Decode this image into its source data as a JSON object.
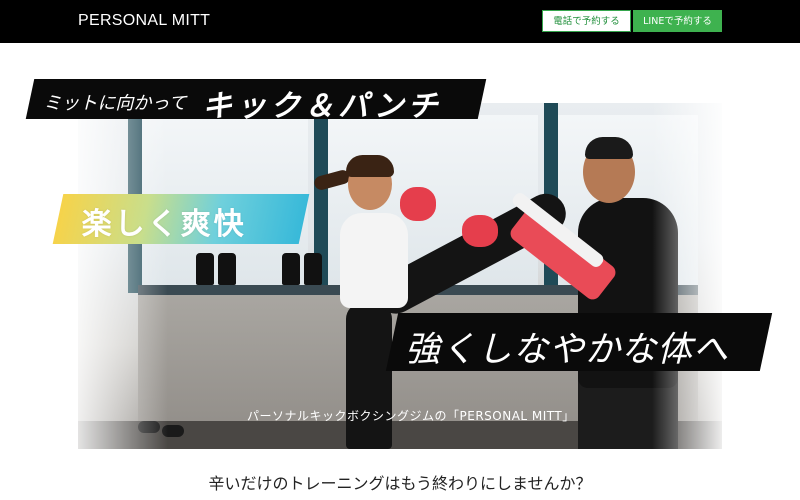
{
  "header": {
    "brand": "PERSONAL MITT",
    "tel_button": "電話で予約する",
    "line_button": "LINEで予約する"
  },
  "hero": {
    "banner_small": "ミットに向かって",
    "banner_big": "キック＆パンチ",
    "banner_fun": "楽しく爽快",
    "banner_strong": "強くしなやかな体へ",
    "caption": "パーソナルキックボクシングジムの「PERSONAL MITT」"
  },
  "lead": "辛いだけのトレーニングはもう終わりにしませんか？",
  "colors": {
    "header_bg": "#000000",
    "line_green": "#3eb24f",
    "glove_red": "#e53e4c"
  }
}
